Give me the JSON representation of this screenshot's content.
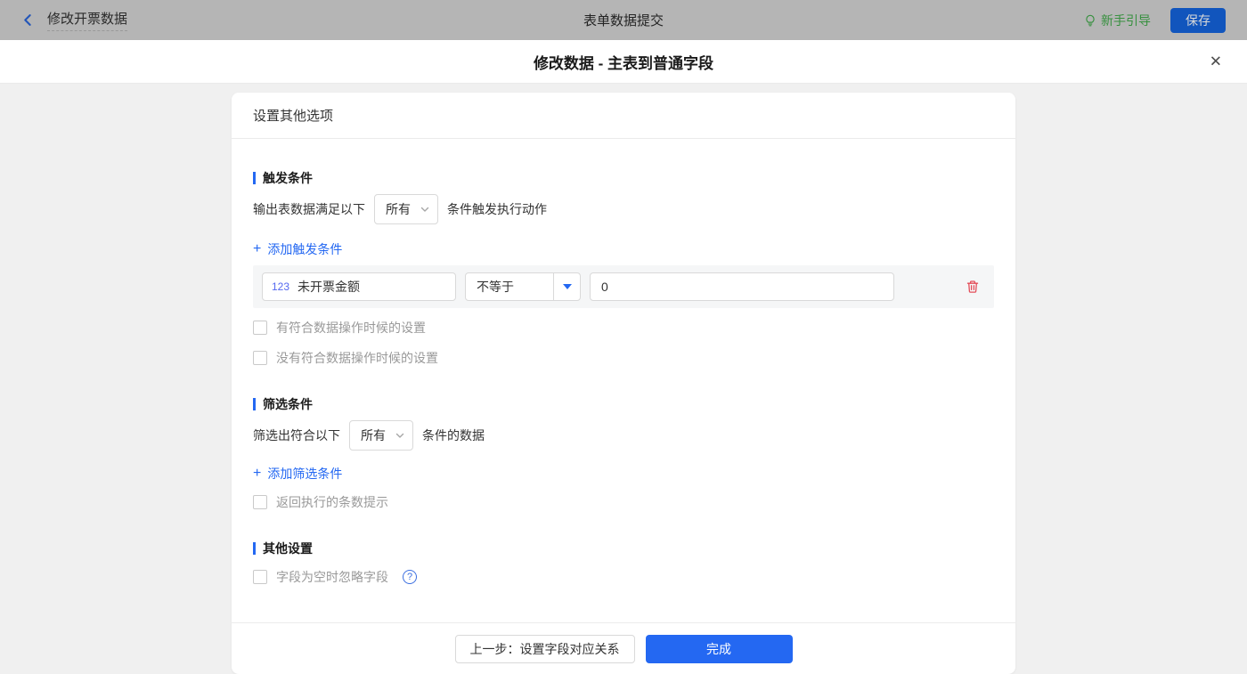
{
  "topbar": {
    "back_label": "修改开票数据",
    "center_title": "表单数据提交",
    "guide_label": "新手引导",
    "save_label": "保存"
  },
  "modal": {
    "title": "修改数据 - 主表到普通字段"
  },
  "card": {
    "header": "设置其他选项",
    "trigger": {
      "title": "触发条件",
      "sentence_prefix": "输出表数据满足以下",
      "select_value": "所有",
      "sentence_suffix": "条件触发执行动作",
      "add_link": "添加触发条件",
      "condition": {
        "field_type": "123",
        "field_name": "未开票金额",
        "operator": "不等于",
        "value": "0"
      },
      "checkboxes": [
        "有符合数据操作时候的设置",
        "没有符合数据操作时候的设置"
      ]
    },
    "filter": {
      "title": "筛选条件",
      "sentence_prefix": "筛选出符合以下",
      "select_value": "所有",
      "sentence_suffix": "条件的数据",
      "add_link": "添加筛选条件",
      "checkboxes": [
        "返回执行的条数提示"
      ]
    },
    "other": {
      "title": "其他设置",
      "checkboxes": [
        "字段为空时忽略字段"
      ]
    },
    "footer": {
      "prev_label": "上一步：设置字段对应关系",
      "done_label": "完成"
    }
  },
  "icons": {
    "plus": "+",
    "close": "✕",
    "question": "?"
  },
  "colors": {
    "accent_blue": "#2468f2",
    "guide_green": "#36903e",
    "danger_red": "#e34d59",
    "save_blue": "#1155bd",
    "topbar_dimmed": "#b5b5b5"
  }
}
